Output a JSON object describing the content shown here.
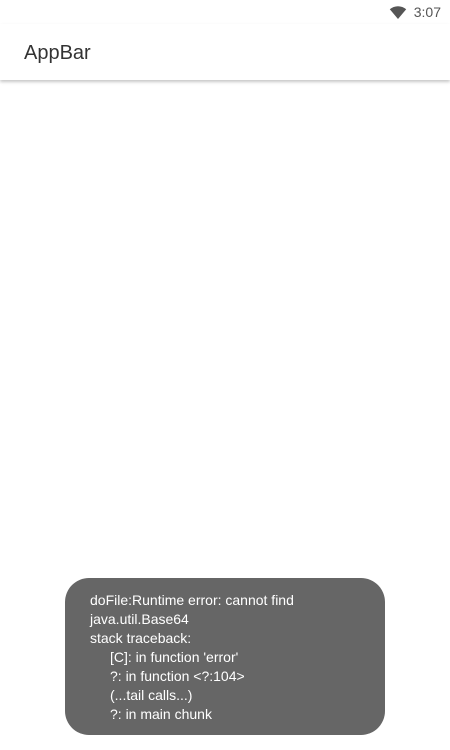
{
  "status_bar": {
    "time": "3:07",
    "wifi_icon": "wifi-icon"
  },
  "app_bar": {
    "title": "AppBar"
  },
  "toast": {
    "lines": [
      "doFile:Runtime error: cannot find",
      "java.util.Base64",
      "stack traceback:",
      "[C]: in function 'error'",
      "?: in function <?:104>",
      "(...tail calls...)",
      "?: in main chunk"
    ]
  },
  "colors": {
    "background": "#ffffff",
    "toast_background": "#666666",
    "toast_text": "#ffffff",
    "title_text": "#333333",
    "status_text": "#555555"
  }
}
